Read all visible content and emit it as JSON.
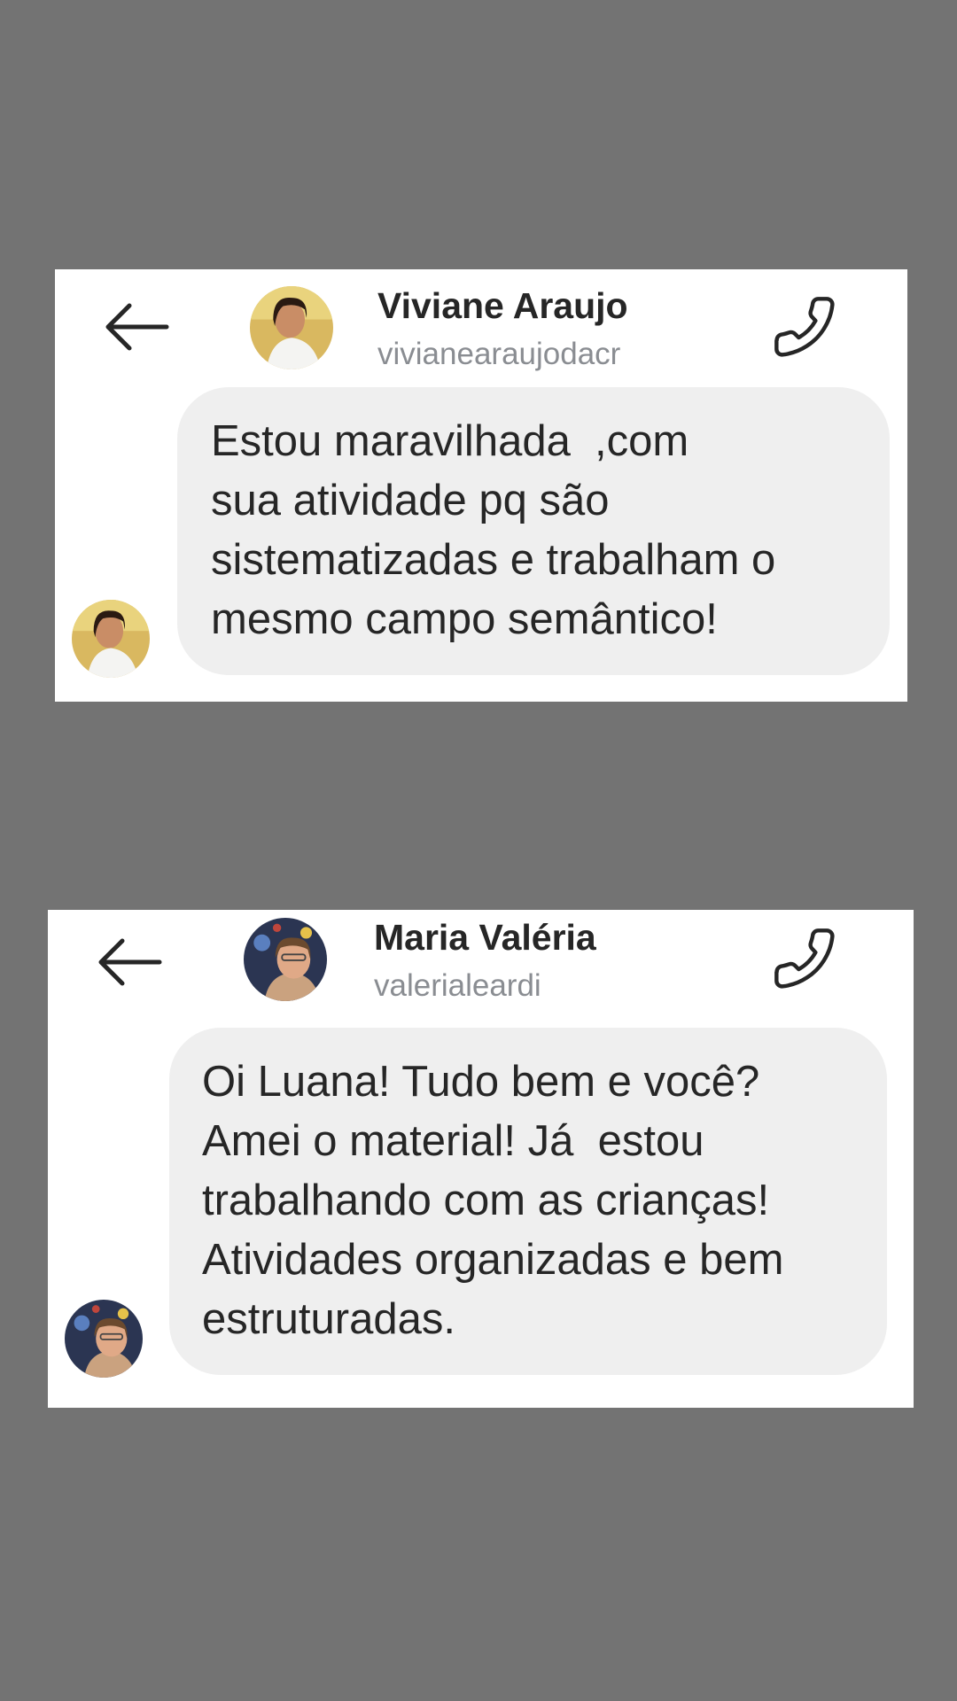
{
  "conversations": [
    {
      "contact": {
        "name": "Viviane Araujo",
        "username": "vivianearaujodacr"
      },
      "message": {
        "lines": [
          "Estou maravilhada  ,com",
          "sua atividade pq são",
          "sistematizadas e trabalham o",
          "mesmo campo semântico!"
        ]
      }
    },
    {
      "contact": {
        "name": "Maria Valéria",
        "username": "valerialeardi"
      },
      "message": {
        "lines": [
          "Oi Luana! Tudo bem e você?",
          "Amei o material! Já  estou",
          "trabalhando com as crianças!",
          "Atividades organizadas e bem",
          "estruturadas."
        ]
      }
    }
  ],
  "icons": {
    "back": "arrow-left-icon",
    "call": "phone-icon"
  },
  "colors": {
    "background": "#737373",
    "card": "#ffffff",
    "bubble": "#efefef",
    "text": "#262626",
    "username": "#8a8d92"
  }
}
